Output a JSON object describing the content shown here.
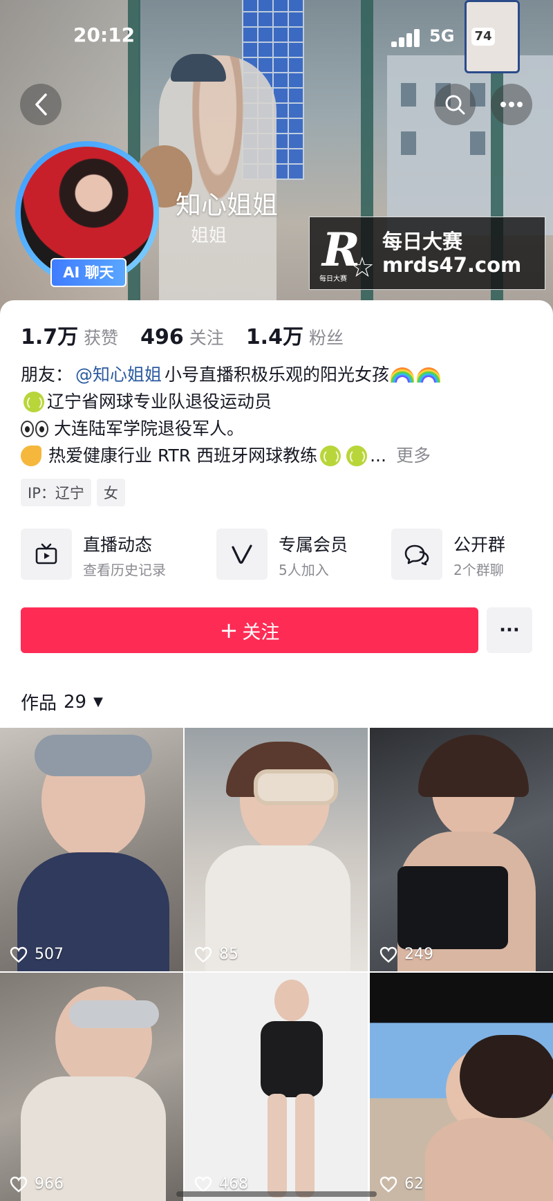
{
  "status_bar": {
    "time": "20:12",
    "network": "5G",
    "battery": "74"
  },
  "header": {
    "profile_name": "知心姐姐",
    "profile_sub": "姐姐",
    "ai_badge": "AI 聊天",
    "watermark": {
      "title": "每日大赛",
      "url": "mrds47.com",
      "logo_letter": "R",
      "logo_small": "每日大赛"
    }
  },
  "stats": [
    {
      "value": "1.7万",
      "label": "获赞"
    },
    {
      "value": "496",
      "label": "关注"
    },
    {
      "value": "1.4万",
      "label": "粉丝"
    }
  ],
  "bio": {
    "line1_prefix": "朋友：",
    "line1_mention": "@知心姐姐",
    "line1_text": "小号直播积极乐观的阳光女孩",
    "line2": "辽宁省网球专业队退役运动员",
    "line3": "大连陆军学院退役军人。",
    "line4": "热爱健康行业 RTR 西班牙网球教练",
    "line4_ellipsis": "...",
    "more": "更多"
  },
  "tags": [
    "IP：辽宁",
    "女"
  ],
  "features": [
    {
      "title": "直播动态",
      "sub": "查看历史记录",
      "icon": "tv-icon"
    },
    {
      "title": "专属会员",
      "sub": "5人加入",
      "icon": "v-icon"
    },
    {
      "title": "公开群",
      "sub": "2个群聊",
      "icon": "chat-icon"
    }
  ],
  "follow": {
    "label": "关注",
    "plus": "+",
    "more": "···"
  },
  "works": {
    "label": "作品",
    "count": "29",
    "caret": "▼"
  },
  "videos": [
    {
      "likes": "507"
    },
    {
      "likes": "85"
    },
    {
      "likes": "249"
    },
    {
      "likes": "966"
    },
    {
      "likes": "468"
    },
    {
      "likes": "62"
    }
  ]
}
